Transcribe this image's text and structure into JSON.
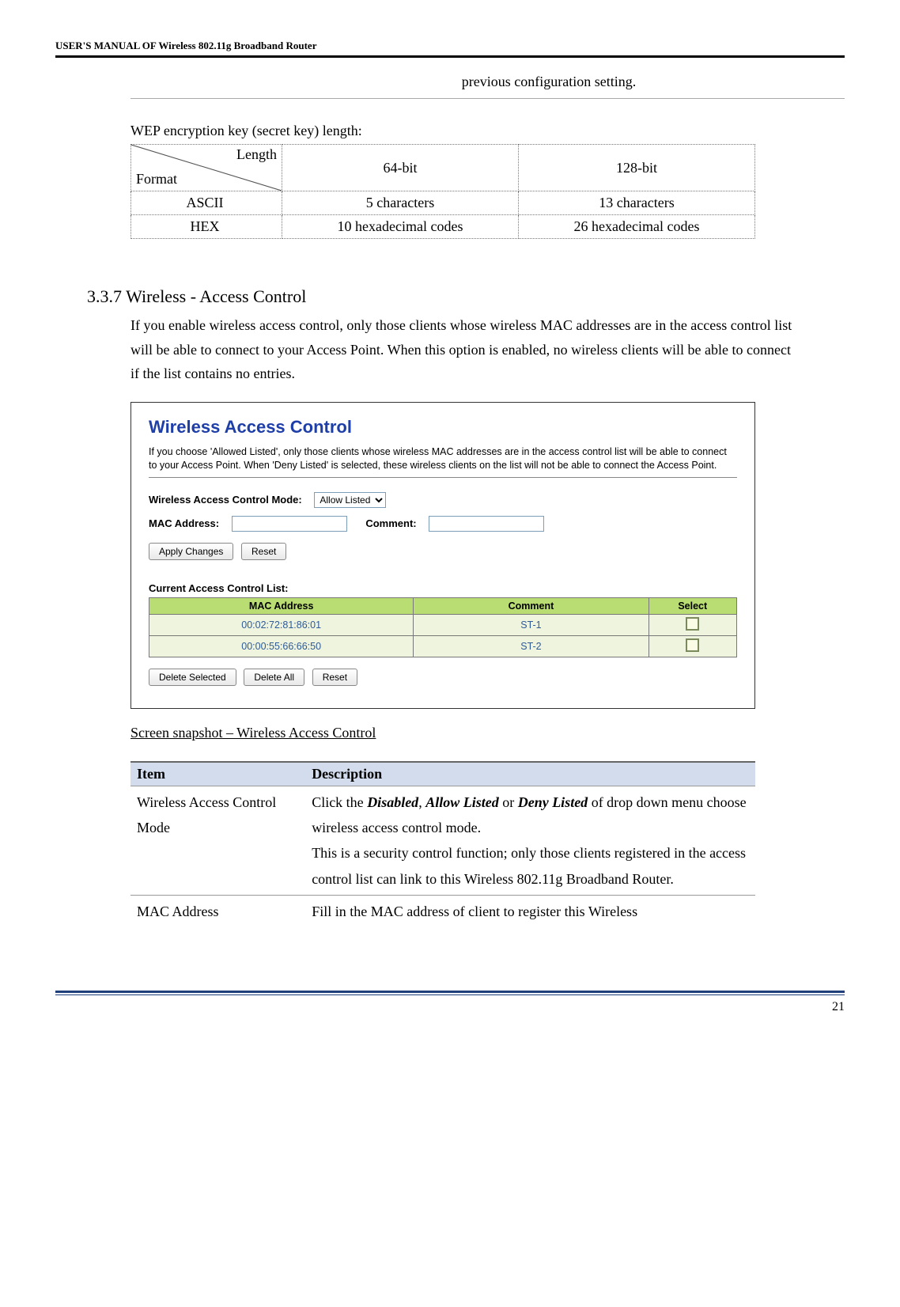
{
  "header": {
    "title": "USER'S MANUAL OF Wireless 802.11g Broadband Router"
  },
  "previous_config": "previous configuration setting.",
  "wep": {
    "caption": "WEP encryption key (secret key) length:",
    "length_header": "Length",
    "format_header": "Format",
    "col64": "64-bit",
    "col128": "128-bit",
    "ascii": {
      "label": "ASCII",
      "v64": "5 characters",
      "v128": "13 characters"
    },
    "hex": {
      "label": "HEX",
      "v64": "10 hexadecimal codes",
      "v128": "26 hexadecimal codes"
    }
  },
  "section": {
    "number": "3.3.7  Wireless - Access Control",
    "body": "If you enable wireless access control, only those clients whose wireless MAC addresses are in the access control list will be able to connect to your Access Point. When this option is enabled, no wireless clients will be able to connect if the list contains no entries."
  },
  "wac": {
    "title": "Wireless Access Control",
    "desc": "If you choose 'Allowed Listed', only those clients whose wireless MAC addresses are in the access control list will be able to connect to your Access Point. When 'Deny Listed' is selected, these wireless clients on the list will not be able to connect the Access Point.",
    "mode_label": "Wireless Access Control Mode:",
    "mode_value": "Allow Listed",
    "mac_label": "MAC Address:",
    "comment_label": "Comment:",
    "apply": "Apply Changes",
    "reset": "Reset",
    "acl_header": "Current Access Control List:",
    "cols": {
      "mac": "MAC Address",
      "comment": "Comment",
      "select": "Select"
    },
    "rows": [
      {
        "mac": "00:02:72:81:86:01",
        "comment": "ST-1"
      },
      {
        "mac": "00:00:55:66:66:50",
        "comment": "ST-2"
      }
    ],
    "delete_selected": "Delete Selected",
    "delete_all": "Delete All",
    "reset2": "Reset"
  },
  "caption": "Screen snapshot – Wireless Access Control",
  "itemtable": {
    "hdr_item": "Item",
    "hdr_desc": "Description",
    "row1": {
      "item": "Wireless Access Control Mode",
      "desc_pre": "Click the ",
      "b1": "Disabled",
      "sep1": ", ",
      "b2": "Allow Listed",
      "sep2": " or ",
      "b3": "Deny Listed",
      "desc_mid": " of drop down menu choose wireless access control mode.",
      "desc2": "This is a security control function; only those clients registered in the access control list can link to this Wireless 802.11g Broadband Router."
    },
    "row2": {
      "item": "MAC Address",
      "desc": "Fill in the MAC address of client to register this Wireless"
    }
  },
  "page_num": "21"
}
